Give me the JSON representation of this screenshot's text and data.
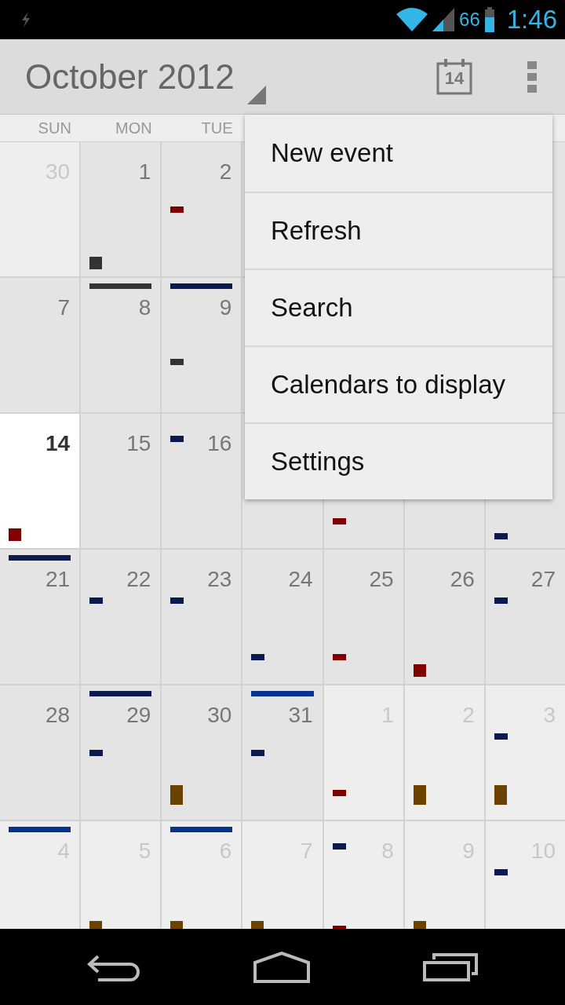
{
  "status_bar": {
    "battery": "66",
    "time": "1:46"
  },
  "action_bar": {
    "title": "October 2012",
    "today_icon": "14"
  },
  "weekdays": [
    "SUN",
    "MON",
    "TUE"
  ],
  "weeks": [
    {
      "days": [
        {
          "day": "30",
          "in_month": false,
          "today": false
        },
        {
          "day": "1",
          "in_month": true,
          "today": false,
          "events": [
            {
              "kind": "night",
              "color": "#333333"
            }
          ]
        },
        {
          "day": "2",
          "in_month": true,
          "today": false,
          "events": [
            {
              "kind": "midday",
              "color": "#800000"
            }
          ]
        }
      ]
    },
    {
      "days": [
        {
          "day": "7",
          "in_month": true,
          "today": false
        },
        {
          "day": "8",
          "in_month": true,
          "today": false,
          "events": [
            {
              "kind": "allday",
              "color": "#333333"
            }
          ]
        },
        {
          "day": "9",
          "in_month": true,
          "today": false,
          "events": [
            {
              "kind": "allday",
              "color": "#0b1a4f"
            },
            {
              "kind": "afternoon",
              "color": "#333333"
            }
          ]
        }
      ]
    },
    {
      "days": [
        {
          "day": "14",
          "in_month": true,
          "today": true,
          "events": [
            {
              "kind": "night",
              "color": "#800000"
            }
          ]
        },
        {
          "day": "15",
          "in_month": true,
          "today": false
        },
        {
          "day": "16",
          "in_month": true,
          "today": false,
          "events": [
            {
              "kind": "early",
              "color": "#0b1a4f"
            }
          ]
        }
      ],
      "events_below_menu": [
        {
          "kind": "evening",
          "color": "#800000"
        },
        {
          "kind": "late",
          "color": "#0b1a4f"
        }
      ]
    },
    {
      "days": [
        {
          "day": "21",
          "in_month": true,
          "today": false,
          "events": [
            {
              "kind": "allday",
              "color": "#0b1a4f"
            }
          ]
        },
        {
          "day": "22",
          "in_month": true,
          "today": false,
          "events": [
            {
              "kind": "morning",
              "color": "#0b1a4f"
            }
          ]
        },
        {
          "day": "23",
          "in_month": true,
          "today": false,
          "events": [
            {
              "kind": "morning",
              "color": "#0b1a4f"
            }
          ]
        },
        {
          "day": "24",
          "in_month": true,
          "today": false,
          "events": [
            {
              "kind": "evening",
              "color": "#0b1a4f"
            }
          ]
        },
        {
          "day": "25",
          "in_month": true,
          "today": false,
          "events": [
            {
              "kind": "evening",
              "color": "#800000"
            }
          ]
        },
        {
          "day": "26",
          "in_month": true,
          "today": false,
          "events": [
            {
              "kind": "night",
              "color": "#800000"
            }
          ]
        },
        {
          "day": "27",
          "in_month": true,
          "today": false,
          "events": [
            {
              "kind": "morning",
              "color": "#0b1a4f"
            }
          ]
        }
      ]
    },
    {
      "days": [
        {
          "day": "28",
          "in_month": true,
          "today": false
        },
        {
          "day": "29",
          "in_month": true,
          "today": false,
          "events": [
            {
              "kind": "allday",
              "color": "#0b1a4f"
            },
            {
              "kind": "midday",
              "color": "#0b1a4f"
            }
          ]
        },
        {
          "day": "30",
          "in_month": true,
          "today": false,
          "events": [
            {
              "kind": "evening",
              "color": "#6b4200"
            }
          ]
        },
        {
          "day": "31",
          "in_month": true,
          "today": false,
          "events": [
            {
              "kind": "allday",
              "color": "#06318f"
            },
            {
              "kind": "midday",
              "color": "#0b1a4f"
            }
          ]
        },
        {
          "day": "1",
          "in_month": false,
          "today": false,
          "events": [
            {
              "kind": "evening",
              "color": "#800000"
            }
          ]
        },
        {
          "day": "2",
          "in_month": false,
          "today": false,
          "events": [
            {
              "kind": "evening",
              "color": "#6b4200"
            }
          ]
        },
        {
          "day": "3",
          "in_month": false,
          "today": false,
          "events": [
            {
              "kind": "morning",
              "color": "#0b1a4f"
            },
            {
              "kind": "evening",
              "color": "#6b4200"
            }
          ]
        }
      ]
    },
    {
      "days": [
        {
          "day": "4",
          "in_month": false,
          "today": false,
          "events": [
            {
              "kind": "allday",
              "color": "#06318f"
            }
          ]
        },
        {
          "day": "5",
          "in_month": false,
          "today": false,
          "events": [
            {
              "kind": "evening",
              "color": "#6b4200"
            }
          ]
        },
        {
          "day": "6",
          "in_month": false,
          "today": false,
          "events": [
            {
              "kind": "allday",
              "color": "#06318f"
            },
            {
              "kind": "evening",
              "color": "#6b4200"
            }
          ]
        },
        {
          "day": "7",
          "in_month": false,
          "today": false,
          "events": [
            {
              "kind": "evening",
              "color": "#6b4200"
            }
          ]
        },
        {
          "day": "8",
          "in_month": false,
          "today": false,
          "events": [
            {
              "kind": "early",
              "color": "#0b1a4f"
            },
            {
              "kind": "evening",
              "color": "#800000"
            }
          ]
        },
        {
          "day": "9",
          "in_month": false,
          "today": false,
          "events": [
            {
              "kind": "evening",
              "color": "#6b4200"
            }
          ]
        },
        {
          "day": "10",
          "in_month": false,
          "today": false,
          "events": [
            {
              "kind": "morning",
              "color": "#0b1a4f"
            }
          ]
        }
      ]
    }
  ],
  "menu": {
    "items": [
      "New event",
      "Refresh",
      "Search",
      "Calendars to display",
      "Settings"
    ]
  }
}
